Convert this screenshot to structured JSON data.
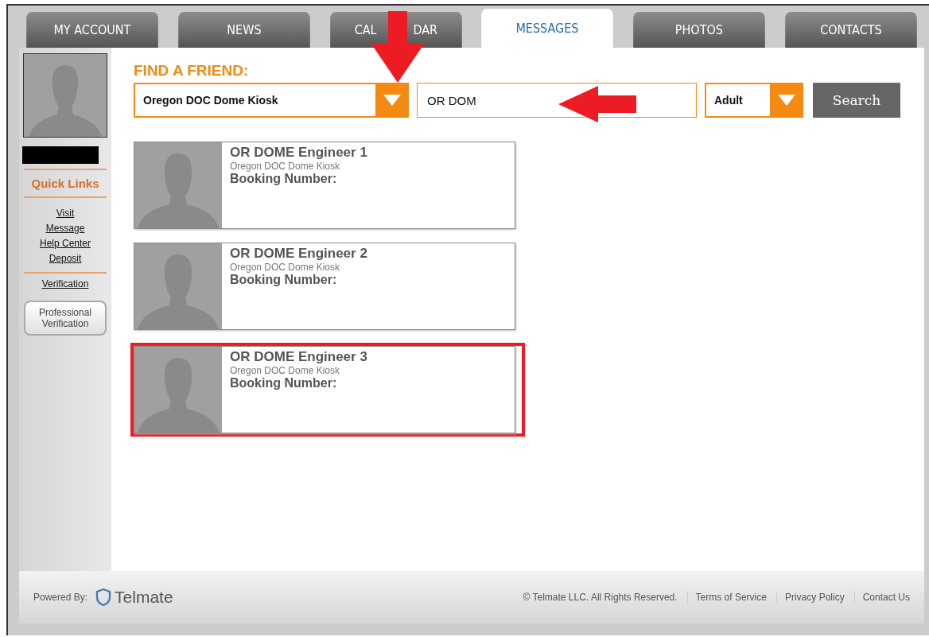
{
  "tabs": [
    {
      "label": "MY ACCOUNT",
      "selected": false
    },
    {
      "label": "NEWS",
      "selected": false
    },
    {
      "label": "CAL          DAR",
      "selected": false
    },
    {
      "label": "MESSAGES",
      "selected": true
    },
    {
      "label": "PHOTOS",
      "selected": false
    },
    {
      "label": "CONTACTS",
      "selected": false
    }
  ],
  "sidebar": {
    "quick_links_title": "Quick Links",
    "links": [
      "Visit",
      "Message",
      "Help Center",
      "Deposit"
    ],
    "verification_link": "Verification",
    "button": "Professional Verification"
  },
  "search": {
    "title": "FIND A FRIEND:",
    "facility": "Oregon DOC Dome Kiosk",
    "query": "OR DOM",
    "type": "Adult",
    "button": "Search"
  },
  "results": [
    {
      "name": "OR DOME Engineer 1",
      "facility": "Oregon DOC Dome Kiosk",
      "booking": "Booking Number:",
      "highlighted": false
    },
    {
      "name": "OR DOME Engineer 2",
      "facility": "Oregon DOC Dome Kiosk",
      "booking": "Booking Number:",
      "highlighted": false
    },
    {
      "name": "OR DOME Engineer 3",
      "facility": "Oregon DOC Dome Kiosk",
      "booking": "Booking Number:",
      "highlighted": true
    }
  ],
  "footer": {
    "powered_by": "Powered By:",
    "brand": "Telmate",
    "copyright": "© Telmate LLC. All Rights Reserved.",
    "links": [
      "Terms of Service",
      "Privacy Policy",
      "Contact Us"
    ]
  }
}
